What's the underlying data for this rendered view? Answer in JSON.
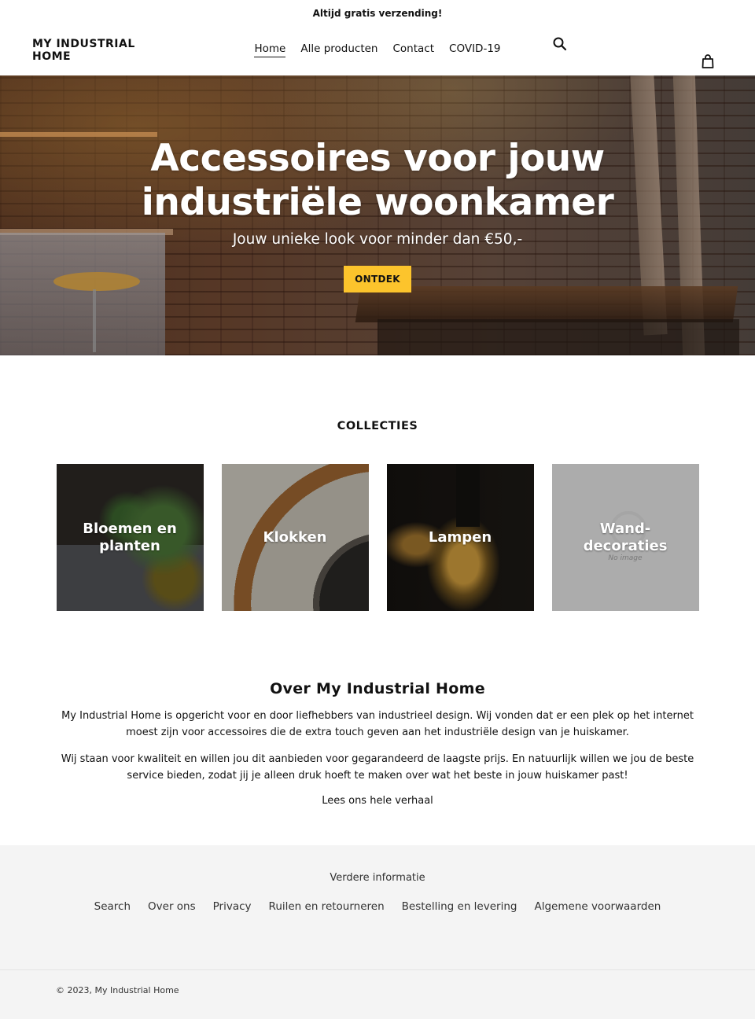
{
  "announcement": {
    "text": "Altijd gratis verzending!"
  },
  "header": {
    "logo": "MY INDUSTRIAL HOME",
    "nav": [
      {
        "label": "Home",
        "active": true
      },
      {
        "label": "Alle producten",
        "active": false
      },
      {
        "label": "Contact",
        "active": false
      },
      {
        "label": "COVID-19",
        "active": false
      }
    ],
    "search_icon": "search-icon",
    "cart_icon": "shopping-bag-icon"
  },
  "hero": {
    "title": "Accessoires voor jouw industriële woonkamer",
    "subtitle": "Jouw unieke look voor minder dan €50,-",
    "button_label": "ONTDEK",
    "button_color": "#fcc42c"
  },
  "collections": {
    "heading": "COLLECTIES",
    "items": [
      {
        "label": "Bloemen en planten"
      },
      {
        "label": "Klokken"
      },
      {
        "label": "Lampen"
      },
      {
        "label": "Wand-decoraties",
        "placeholder_text": "No image"
      }
    ]
  },
  "about": {
    "heading": "Over My Industrial Home",
    "paragraphs": [
      "My Industrial Home is opgericht voor en door liefhebbers van industrieel design. Wij vonden dat er een plek op het internet moest zijn voor accessoires die de extra touch geven aan het industriële design van je huiskamer.",
      "Wij staan voor kwaliteit en willen jou dit aanbieden voor gegarandeerd de laagste prijs. En natuurlijk willen we jou de beste service bieden, zodat jij je alleen druk hoeft te maken over wat het beste in jouw huiskamer past!"
    ],
    "link_label": "Lees ons hele verhaal"
  },
  "footer": {
    "title": "Verdere informatie",
    "links": [
      {
        "label": "Search"
      },
      {
        "label": "Over ons"
      },
      {
        "label": "Privacy"
      },
      {
        "label": "Ruilen en retourneren"
      },
      {
        "label": "Bestelling en levering"
      },
      {
        "label": "Algemene voorwaarden"
      }
    ],
    "copyright": "© 2023, My Industrial Home"
  }
}
